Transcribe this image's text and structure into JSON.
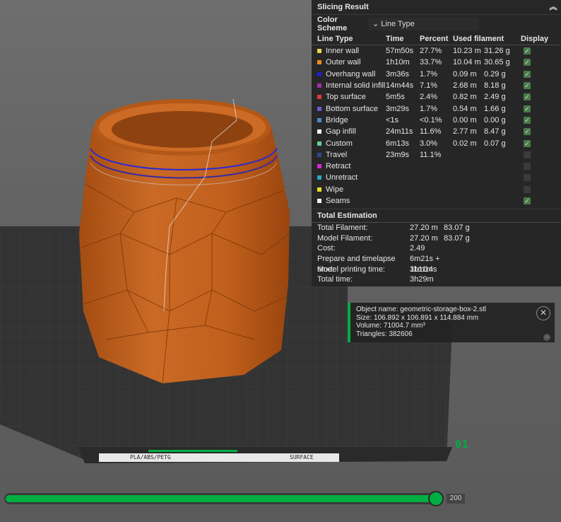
{
  "panel": {
    "title": "Slicing Result",
    "collapse_icon": "chevron-up-icon",
    "color_scheme_label": "Color Scheme",
    "color_scheme_value": "Line Type",
    "columns": [
      "Line Type",
      "Time",
      "Percent",
      "Used filament",
      "Display"
    ],
    "rows": [
      {
        "name": "Inner wall",
        "color": "#e9d54a",
        "time": "57m50s",
        "percent": "27.7%",
        "length": "10.23 m",
        "weight": "31.26 g",
        "checked": true
      },
      {
        "name": "Outer wall",
        "color": "#f08a1e",
        "time": "1h10m",
        "percent": "33.7%",
        "length": "10.04 m",
        "weight": "30.65 g",
        "checked": true
      },
      {
        "name": "Overhang wall",
        "color": "#1f1fd6",
        "time": "3m36s",
        "percent": "1.7%",
        "length": "0.09 m",
        "weight": "0.29 g",
        "checked": true
      },
      {
        "name": "Internal solid infill",
        "color": "#a52fa8",
        "time": "14m44s",
        "percent": "7.1%",
        "length": "2.68 m",
        "weight": "8.18 g",
        "checked": true
      },
      {
        "name": "Top surface",
        "color": "#e03a3a",
        "time": "5m5s",
        "percent": "2.4%",
        "length": "0.82 m",
        "weight": "2.49 g",
        "checked": true
      },
      {
        "name": "Bottom surface",
        "color": "#6a5acd",
        "time": "3m29s",
        "percent": "1.7%",
        "length": "0.54 m",
        "weight": "1.66 g",
        "checked": true
      },
      {
        "name": "Bridge",
        "color": "#4d8ac6",
        "time": "<1s",
        "percent": "<0.1%",
        "length": "0.00 m",
        "weight": "0.00 g",
        "checked": true
      },
      {
        "name": "Gap infill",
        "color": "#ffffff",
        "time": "24m11s",
        "percent": "11.6%",
        "length": "2.77 m",
        "weight": "8.47 g",
        "checked": true
      },
      {
        "name": "Custom",
        "color": "#5fd38c",
        "time": "6m13s",
        "percent": "3.0%",
        "length": "0.02 m",
        "weight": "0.07 g",
        "checked": true
      },
      {
        "name": "Travel",
        "color": "#2e4a8c",
        "time": "23m9s",
        "percent": "11.1%",
        "length": "",
        "weight": "",
        "checked": false
      },
      {
        "name": "Retract",
        "color": "#d12bd1",
        "time": "",
        "percent": "",
        "length": "",
        "weight": "",
        "checked": false
      },
      {
        "name": "Unretract",
        "color": "#2aa8c8",
        "time": "",
        "percent": "",
        "length": "",
        "weight": "",
        "checked": false
      },
      {
        "name": "Wipe",
        "color": "#e8e02a",
        "time": "",
        "percent": "",
        "length": "",
        "weight": "",
        "checked": false
      },
      {
        "name": "Seams",
        "color": "#f2f2f2",
        "time": "",
        "percent": "",
        "length": "",
        "weight": "",
        "checked": true
      }
    ],
    "total_title": "Total Estimation",
    "totals": [
      {
        "label": "Total Filament:",
        "v1": "27.20 m",
        "v2": "83.07 g"
      },
      {
        "label": "Model Filament:",
        "v1": "27.20 m",
        "v2": "83.07 g"
      },
      {
        "label": "Cost:",
        "v1": "2.49",
        "v2": ""
      },
      {
        "label": "Prepare and timelapse time:",
        "v1": "6m21s + 11m14s",
        "v2": ""
      },
      {
        "label": "Model printing time:",
        "v1": "3h11m",
        "v2": ""
      },
      {
        "label": "Total time:",
        "v1": "3h29m",
        "v2": ""
      }
    ]
  },
  "object_info": {
    "name": "Object name: geometric-storage-box-2.stl",
    "size": "Size: 106.892 x 106.891 x 114.884 mm",
    "volume": "Volume: 71004.7 mm³",
    "triangles": "Triangles: 382606",
    "close_icon": "close-icon",
    "minimize_icon": "minimize-icon"
  },
  "plate": {
    "number": "01",
    "label_left": "PLA/ABS/PETG",
    "label_right": "SURFACE"
  },
  "layer_slider": {
    "value": "200",
    "fraction": 1.0
  },
  "colors": {
    "accent": "#00ae42",
    "model": "#c8621c",
    "panel": "#232323"
  }
}
